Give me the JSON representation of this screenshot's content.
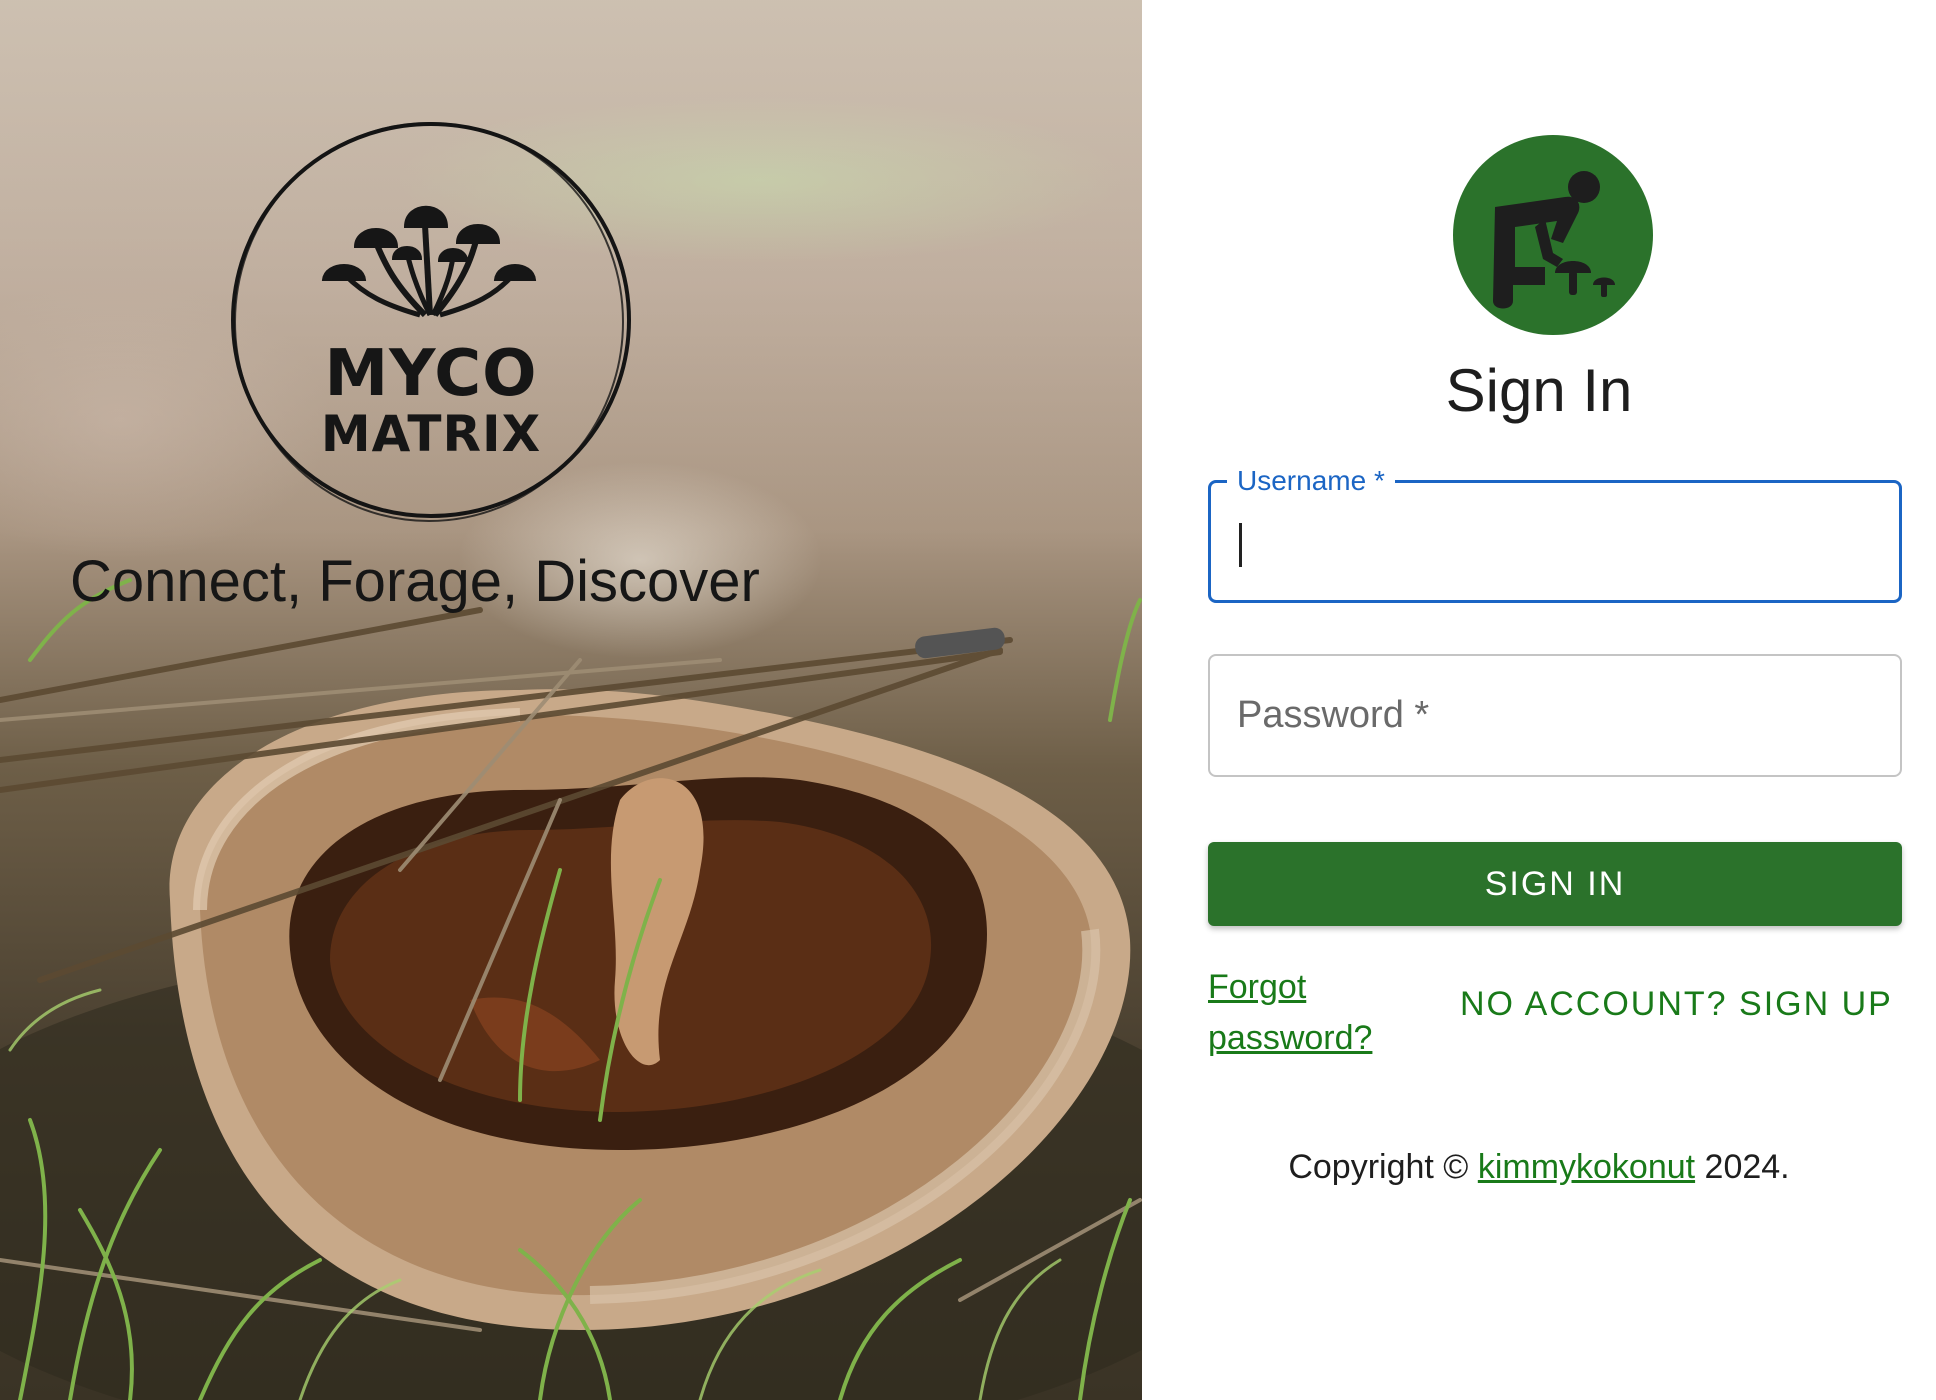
{
  "hero": {
    "logo_line1": "MYCO",
    "logo_line2": "MATRIX",
    "tagline": "Connect, Forage, Discover",
    "logo_icon": "mushroom-cluster-icon"
  },
  "form": {
    "avatar_icon": "forager-picking-mushrooms-icon",
    "title": "Sign In",
    "username_label": "Username *",
    "username_value": "",
    "password_placeholder": "Password *",
    "submit_label": "SIGN IN",
    "forgot_label": "Forgot password?",
    "signup_label": "NO ACCOUNT? SIGN UP"
  },
  "footer": {
    "prefix": "Copyright ©",
    "author": "kimmykokonut",
    "year": "2024."
  },
  "colors": {
    "brand_green": "#2b722b",
    "link_green": "#197a19",
    "focus_blue": "#1b65c4"
  }
}
